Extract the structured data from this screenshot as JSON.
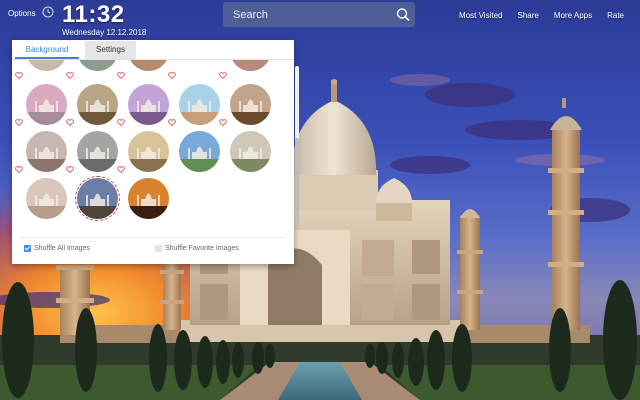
{
  "header": {
    "options_label": "Options",
    "time": "11:32",
    "date": "Wednesday  12.12.2018"
  },
  "search": {
    "placeholder": "Search"
  },
  "nav_links": [
    "Most Visited",
    "Share",
    "More Apps",
    "Rate"
  ],
  "panel": {
    "tabs": [
      "Background",
      "Settings"
    ],
    "active_tab": "Background",
    "shuffle_all_label": "Shuffle All Images",
    "shuffle_all_checked": true,
    "shuffle_favorite_label": "Shuffle Favorite Images",
    "shuffle_favorite_checked": false,
    "thumbnails": [
      {
        "name": "pink-sunset-taj",
        "sky": "#d8a9bf",
        "ground": "#a98c9c"
      },
      {
        "name": "taj-garden-day",
        "sky": "#b7a585",
        "ground": "#6e5a3a"
      },
      {
        "name": "taj-purple-dusk",
        "sky": "#c3a4d8",
        "ground": "#7a5a8f"
      },
      {
        "name": "taj-lake-reflection",
        "sky": "#a7d2e8",
        "ground": "#c99f7a"
      },
      {
        "name": "taj-arch-view",
        "sky": "#c2a48c",
        "ground": "#6b4a2c"
      },
      {
        "name": "taj-misty-morning",
        "sky": "#c7b7b0",
        "ground": "#8c7569"
      },
      {
        "name": "taj-grey-sky",
        "sky": "#a4a4a4",
        "ground": "#6b6b6b"
      },
      {
        "name": "taj-golden-hour",
        "sky": "#d9c39a",
        "ground": "#8b7250"
      },
      {
        "name": "taj-blue-sky-lawn",
        "sky": "#79a9d8",
        "ground": "#5f8f52"
      },
      {
        "name": "taj-cream-facade",
        "sky": "#cfc7b8",
        "ground": "#7e8a62"
      },
      {
        "name": "taj-reflection-pool",
        "sky": "#d9c7bc",
        "ground": "#b89c8c"
      },
      {
        "name": "taj-twilight-selected",
        "sky": "#6b7ea8",
        "ground": "#4e4438"
      },
      {
        "name": "taj-silhouette-sunset",
        "sky": "#d9822b",
        "ground": "#3a1e12"
      }
    ],
    "partial_row_colors": [
      "#c9b8a8",
      "#8f9a90",
      "#b48c6c",
      "#b88a7a"
    ]
  },
  "colors": {
    "accent": "#3a86d6",
    "heart": "#e06060",
    "search_bg": "#5c6c96"
  }
}
